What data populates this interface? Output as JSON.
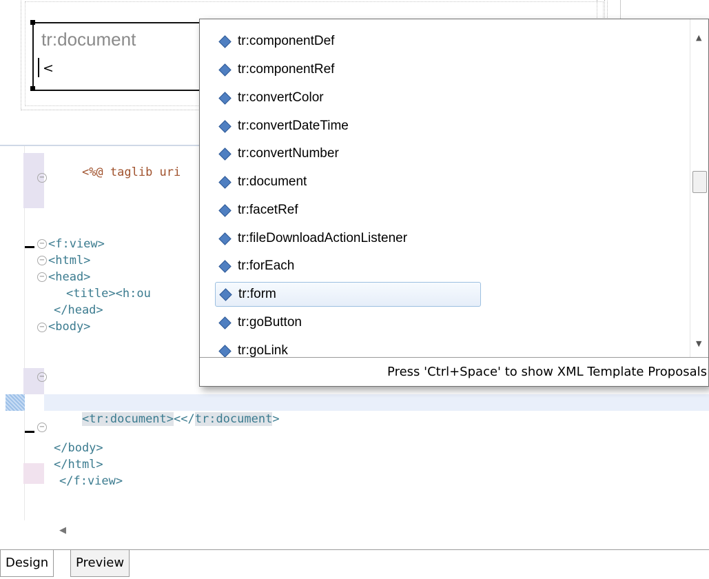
{
  "design": {
    "title": "tr:document",
    "child_text": "<"
  },
  "editor": {
    "lines": {
      "taglib": "<%@ taglib uri",
      "fview": "<f:view>",
      "html": "<html>",
      "head": "<head>",
      "title": "<title><h:ou",
      "head_close": "</head>",
      "body": "<body>",
      "doc_open": "<tr:document>",
      "doc_mid": "<</",
      "doc_close": "tr:document",
      "doc_end": ">",
      "body_close": "</body>",
      "html_close": "</html>",
      "fview_close": "</f:view>"
    }
  },
  "content_assist": {
    "proposals": [
      "tr:componentDef",
      "tr:componentRef",
      "tr:convertColor",
      "tr:convertDateTime",
      "tr:convertNumber",
      "tr:document",
      "tr:facetRef",
      "tr:fileDownloadActionListener",
      "tr:forEach",
      "tr:form",
      "tr:goButton",
      "tr:goLink"
    ],
    "selected": "tr:form",
    "status_text": "Press 'Ctrl+Space' to show XML Template Proposals"
  },
  "tabs": {
    "design": "Design",
    "preview": "Preview"
  },
  "colors": {
    "tag": "#3b7b8f",
    "directive": "#7f3f97",
    "proposal_icon": "#4f7fc1",
    "selection_border": "#9cbfe0"
  }
}
